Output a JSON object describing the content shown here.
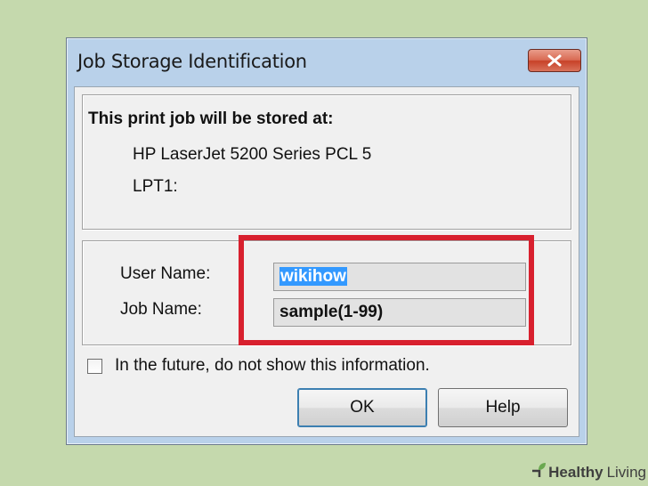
{
  "dialog": {
    "title": "Job Storage Identification",
    "close_icon": "close-x-icon"
  },
  "info": {
    "heading": "This print job will be stored at:",
    "printer": "HP LaserJet 5200 Series PCL 5",
    "port": "LPT1:"
  },
  "fields": {
    "user_label": "User Name:",
    "user_value": "wikihow",
    "job_label": "Job Name:",
    "job_value": "sample(1-99)"
  },
  "checkbox": {
    "label": "In the future, do not show this information.",
    "checked": false
  },
  "buttons": {
    "ok": "OK",
    "help": "Help"
  },
  "watermark": {
    "brand_bold": "Healthy",
    "brand_rest": "Living",
    "icon": "leaf-icon"
  },
  "colors": {
    "background": "#c5d9ad",
    "highlight": "#d8202e",
    "selection": "#3399ff",
    "close_button": "#c74128"
  }
}
